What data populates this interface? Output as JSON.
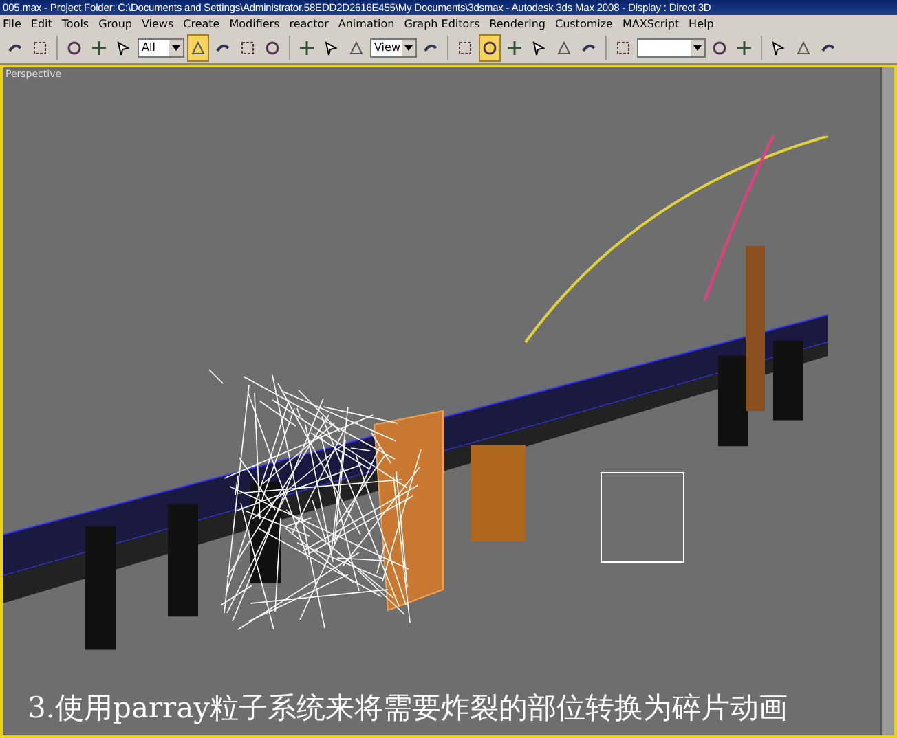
{
  "window": {
    "title": "005.max  - Project Folder: C:\\Documents and Settings\\Administrator.58EDD2D2616E455\\My Documents\\3dsmax   - Autodesk 3ds Max 2008    - Display : Direct 3D"
  },
  "menu": [
    "File",
    "Edit",
    "Tools",
    "Group",
    "Views",
    "Create",
    "Modifiers",
    "reactor",
    "Animation",
    "Graph Editors",
    "Rendering",
    "Customize",
    "MAXScript",
    "Help"
  ],
  "toolbar": [
    {
      "kind": "icon",
      "active": false
    },
    {
      "kind": "icon",
      "active": false
    },
    {
      "kind": "sep"
    },
    {
      "kind": "icon",
      "active": false
    },
    {
      "kind": "icon",
      "active": false
    },
    {
      "kind": "icon",
      "active": false
    },
    {
      "kind": "dropdown",
      "value": "All"
    },
    {
      "kind": "icon",
      "active": true
    },
    {
      "kind": "icon",
      "active": false
    },
    {
      "kind": "icon",
      "active": false
    },
    {
      "kind": "icon",
      "active": false
    },
    {
      "kind": "sep"
    },
    {
      "kind": "icon",
      "active": false
    },
    {
      "kind": "icon",
      "active": false
    },
    {
      "kind": "icon",
      "active": false
    },
    {
      "kind": "dropdown",
      "value": "View"
    },
    {
      "kind": "icon",
      "active": false
    },
    {
      "kind": "sep"
    },
    {
      "kind": "icon",
      "active": false
    },
    {
      "kind": "icon",
      "active": true
    },
    {
      "kind": "icon",
      "active": false
    },
    {
      "kind": "icon",
      "active": false
    },
    {
      "kind": "icon",
      "active": false
    },
    {
      "kind": "icon",
      "active": false
    },
    {
      "kind": "sep"
    },
    {
      "kind": "icon",
      "active": false
    },
    {
      "kind": "dropdown"
    },
    {
      "kind": "icon",
      "active": false
    },
    {
      "kind": "icon",
      "active": false
    },
    {
      "kind": "sep"
    },
    {
      "kind": "icon",
      "active": false
    },
    {
      "kind": "icon",
      "active": false
    },
    {
      "kind": "icon",
      "active": false
    }
  ],
  "viewport": {
    "label": "Perspective",
    "active": true,
    "caption": "3.使用parray粒子系统来将需要炸裂的部位转换为碎片动画"
  }
}
